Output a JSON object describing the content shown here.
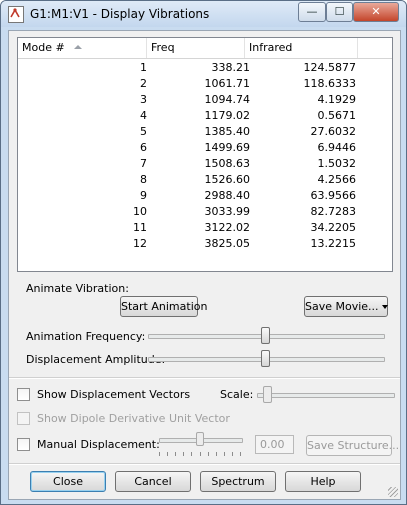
{
  "window": {
    "title": "G1:M1:V1 - Display Vibrations"
  },
  "titlebar_buttons": {
    "minimize": "—",
    "maximize": "☐",
    "close": "✕"
  },
  "table": {
    "headers": {
      "mode": "Mode #",
      "freq": "Freq",
      "ir": "Infrared"
    },
    "rows": [
      [
        "1",
        "338.21",
        "124.5877"
      ],
      [
        "2",
        "1061.71",
        "118.6333"
      ],
      [
        "3",
        "1094.74",
        "4.1929"
      ],
      [
        "4",
        "1179.02",
        "0.5671"
      ],
      [
        "5",
        "1385.40",
        "27.6032"
      ],
      [
        "6",
        "1499.69",
        "6.9446"
      ],
      [
        "7",
        "1508.63",
        "1.5032"
      ],
      [
        "8",
        "1526.60",
        "4.2566"
      ],
      [
        "9",
        "2988.40",
        "63.9566"
      ],
      [
        "10",
        "3033.99",
        "82.7283"
      ],
      [
        "11",
        "3122.02",
        "34.2205"
      ],
      [
        "12",
        "3825.05",
        "13.2215"
      ]
    ]
  },
  "animate": {
    "label": "Animate Vibration:",
    "start_button": "Start Animation",
    "save_movie_button": "Save Movie...",
    "frequency_label": "Animation Frequency:",
    "frequency_level": 0.5,
    "amplitude_label": "Displacement Amplitude:",
    "amplitude_level": 0.5
  },
  "vectors": {
    "show_displacement_label": "Show Displacement Vectors",
    "show_displacement_checked": false,
    "scale_label": "Scale:",
    "scale_level": 0.05,
    "show_dipole_label": "Show Dipole Derivative Unit Vector",
    "show_dipole_enabled": false
  },
  "manual": {
    "label": "Manual Displacement:",
    "checked": false,
    "slider_level": 0.5,
    "value": "0.00",
    "save_structure_button": "Save Structure..."
  },
  "footer": {
    "close": "Close",
    "cancel": "Cancel",
    "spectrum": "Spectrum",
    "help": "Help"
  }
}
